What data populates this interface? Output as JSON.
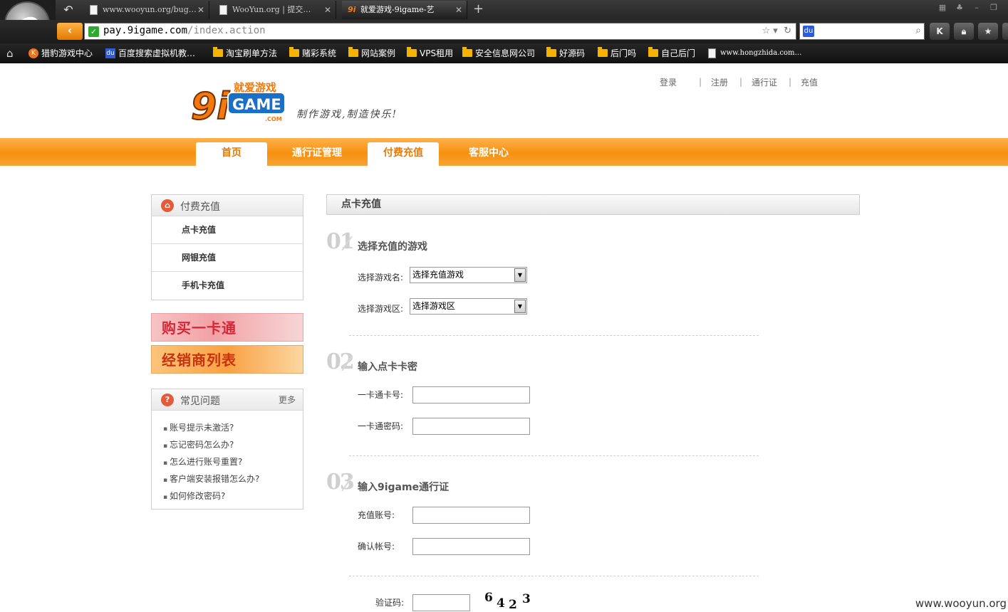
{
  "browser": {
    "tabs": [
      {
        "title": "www.wooyun.org/bug…"
      },
      {
        "title": "WooYun.org | 提交…"
      },
      {
        "title": "就爱游戏-9igame-艺",
        "favicon_text": "9i"
      }
    ],
    "url_host": "pay.9igame.com",
    "url_path": "/index.action",
    "bookmarks": [
      {
        "label": "猎豹游戏中心",
        "icon": "kico"
      },
      {
        "label": "百度搜索虚拟机教…",
        "icon": "baidu"
      },
      {
        "label": "淘宝刷单方法",
        "icon": "folder"
      },
      {
        "label": "赌彩系统",
        "icon": "folder"
      },
      {
        "label": "网站案例",
        "icon": "folder"
      },
      {
        "label": "VPS租用",
        "icon": "folder"
      },
      {
        "label": "安全信息网公司",
        "icon": "folder"
      },
      {
        "label": "好源码",
        "icon": "folder"
      },
      {
        "label": "后门吗",
        "icon": "folder"
      },
      {
        "label": "自己后门",
        "icon": "folder"
      },
      {
        "label": "www.hongzhida.com…",
        "icon": "page"
      }
    ],
    "toolbar_buttons": [
      "K",
      "lock",
      "star"
    ]
  },
  "site": {
    "slogan": "制作游戏,制造快乐!",
    "toplinks": [
      "登录",
      "注册",
      "通行证",
      "充值"
    ],
    "nav": [
      {
        "label": "首页",
        "active": true
      },
      {
        "label": "通行证管理",
        "active": false
      },
      {
        "label": "付费充值",
        "active": true
      },
      {
        "label": "客服中心",
        "active": false
      }
    ]
  },
  "sidebar": {
    "pay_title": "付费充值",
    "pay_items": [
      "点卡充值",
      "网银充值",
      "手机卡充值"
    ],
    "banner1": "购买一卡通",
    "banner2": "经销商列表",
    "faq_title": "常见问题",
    "faq_more": "更多",
    "faq_items": [
      "账号提示未激活?",
      "忘记密码怎么办?",
      "怎么进行账号重置?",
      "客户端安装报错怎么办?",
      "如何修改密码?"
    ]
  },
  "main": {
    "title": "点卡充值",
    "step1": {
      "num": "01",
      "title": "选择充值的游戏",
      "game_label": "选择游戏名:",
      "game_value": "选择充值游戏",
      "zone_label": "选择游戏区:",
      "zone_value": "选择游戏区"
    },
    "step2": {
      "num": "02",
      "title": "输入点卡卡密",
      "card_label": "一卡通卡号:",
      "pwd_label": "一卡通密码:"
    },
    "step3": {
      "num": "03",
      "title": "输入9igame通行证",
      "account_label": "充值账号:",
      "confirm_label": "确认帐号:"
    },
    "captcha_label": "验证码:",
    "captcha_chars": [
      "6",
      "4",
      "2",
      "3"
    ]
  },
  "watermark": "www.wooyun.org",
  "colors": {
    "accent": "#f6900f",
    "nav_active_text": "#e87b00"
  }
}
